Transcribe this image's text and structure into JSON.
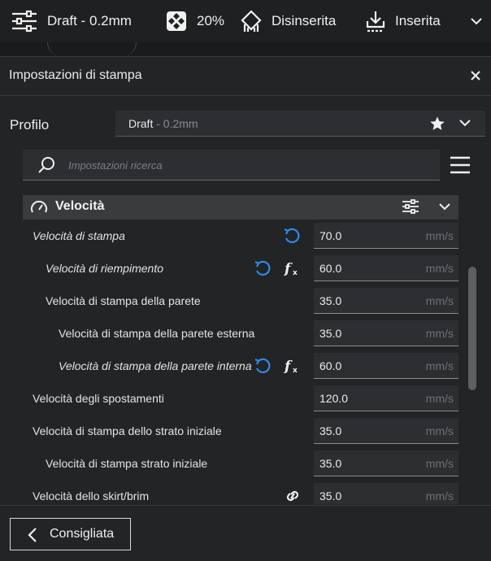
{
  "toolbar": {
    "profile": "Draft - 0.2mm",
    "infill": "20%",
    "support": "Disinserita",
    "adhesion": "Inserita"
  },
  "panel": {
    "title": "Impostazioni di stampa",
    "profile_label": "Profilo",
    "profile_name": "Draft",
    "profile_quality": " - 0.2mm",
    "search_placeholder": "Impostazioni ricerca",
    "category": "Velocità",
    "footer_button": "Consigliata"
  },
  "settings": [
    {
      "label": "Velocità di stampa",
      "italic": true,
      "indent": 0,
      "value": "70.0",
      "unit": "mm/s",
      "icons": [
        "reset-icon"
      ]
    },
    {
      "label": "Velocità di riempimento",
      "italic": true,
      "indent": 1,
      "value": "60.0",
      "unit": "mm/s",
      "icons": [
        "reset-icon",
        "function-icon"
      ]
    },
    {
      "label": "Velocità di stampa della parete",
      "italic": false,
      "indent": 1,
      "value": "35.0",
      "unit": "mm/s",
      "icons": []
    },
    {
      "label": "Velocità di stampa della parete esterna",
      "italic": false,
      "indent": 2,
      "value": "35.0",
      "unit": "mm/s",
      "icons": []
    },
    {
      "label": "Velocità di stampa della parete interna",
      "italic": true,
      "indent": 2,
      "value": "60.0",
      "unit": "mm/s",
      "icons": [
        "reset-icon",
        "function-icon"
      ]
    },
    {
      "label": "Velocità degli spostamenti",
      "italic": false,
      "indent": 0,
      "value": "120.0",
      "unit": "mm/s",
      "icons": []
    },
    {
      "label": "Velocità di stampa dello strato iniziale",
      "italic": false,
      "indent": 0,
      "value": "35.0",
      "unit": "mm/s",
      "icons": []
    },
    {
      "label": "Velocità di stampa strato iniziale",
      "italic": false,
      "indent": 1,
      "value": "35.0",
      "unit": "mm/s",
      "icons": []
    },
    {
      "label": "Velocità dello skirt/brim",
      "italic": false,
      "indent": 0,
      "value": "35.0",
      "unit": "mm/s",
      "icons": [
        "link-icon"
      ]
    }
  ],
  "colors": {
    "accent": "#2a8bf0",
    "background": "#232426",
    "field": "#2d2e31"
  }
}
